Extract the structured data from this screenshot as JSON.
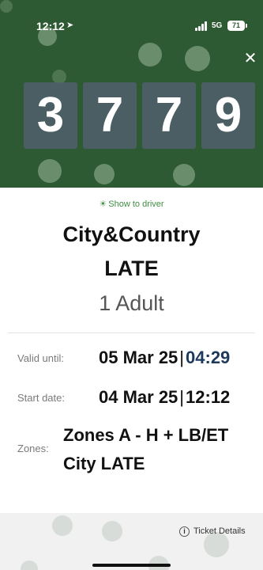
{
  "status_bar": {
    "time": "12:12",
    "network": "5G",
    "battery": "71"
  },
  "code": {
    "digits": [
      "3",
      "7",
      "7",
      "9"
    ]
  },
  "ticket": {
    "show_to_driver": "Show to driver",
    "title_line1": "City&Country",
    "title_line2": "LATE",
    "passengers": "1 Adult",
    "valid_until_label": "Valid until:",
    "valid_until_date": "05 Mar 25",
    "valid_until_time": "04:29",
    "start_date_label": "Start date:",
    "start_date_date": "04 Mar 25",
    "start_date_time": "12:12",
    "zones_label": "Zones:",
    "zones_line1": "Zones A - H + LB/ET",
    "zones_line2": "City LATE"
  },
  "footer": {
    "ticket_details": "Ticket Details"
  },
  "colors": {
    "header_green": "#2d5a32",
    "accent_green": "#3e8e41"
  }
}
